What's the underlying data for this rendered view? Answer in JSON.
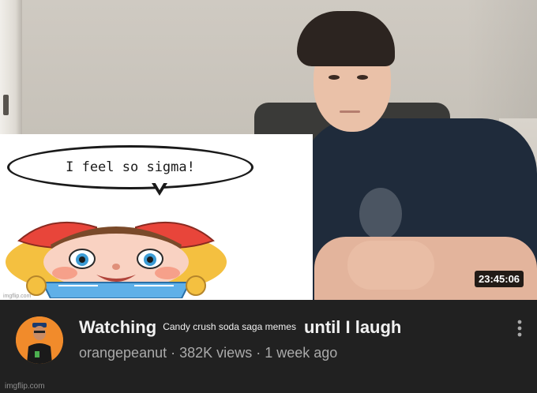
{
  "thumbnail": {
    "meme_text": "I feel so sigma!",
    "timestamp": "23:45:06"
  },
  "video": {
    "title_part1": "Watching",
    "title_inserted": "Candy crush soda saga memes",
    "title_part2": "until I laugh",
    "channel": "orangepeanut",
    "views": "382K views",
    "age": "1 week ago",
    "separator": "·"
  },
  "icons": {
    "more": "vertical-ellipsis-icon",
    "avatar": "channel-avatar"
  },
  "colors": {
    "background": "#212121",
    "title": "#f1f1f1",
    "meta": "#aaaaaa",
    "avatar_bg": "#f18b2b"
  },
  "watermark": "imgflip.com"
}
